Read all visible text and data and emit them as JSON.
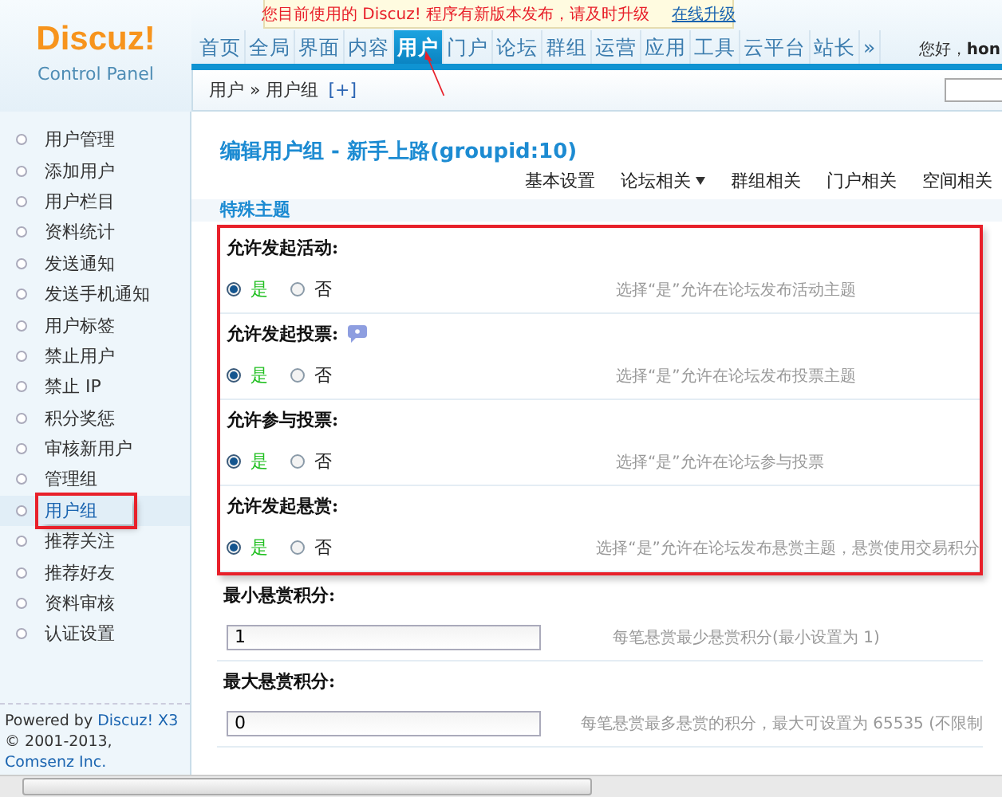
{
  "update_notice": {
    "message": "您目前使用的 Discuz! 程序有新版本发布，请及时升级",
    "link": "在线升级"
  },
  "logo": {
    "name": "Discuz!",
    "subtitle": "Control Panel"
  },
  "nav": [
    {
      "label": "首页",
      "selected": false
    },
    {
      "label": "全局",
      "selected": false
    },
    {
      "label": "界面",
      "selected": false
    },
    {
      "label": "内容",
      "selected": false
    },
    {
      "label": "用户",
      "selected": true
    },
    {
      "label": "门户",
      "selected": false
    },
    {
      "label": "论坛",
      "selected": false
    },
    {
      "label": "群组",
      "selected": false
    },
    {
      "label": "运营",
      "selected": false
    },
    {
      "label": "应用",
      "selected": false
    },
    {
      "label": "工具",
      "selected": false
    },
    {
      "label": "云平台",
      "selected": false
    },
    {
      "label": "站长",
      "selected": false
    },
    {
      "label": "»",
      "selected": false
    }
  ],
  "greeting": {
    "text": "您好，",
    "user": "hon"
  },
  "breadcrumb": {
    "path": "用户 » 用户组",
    "add": "[+]"
  },
  "sidebar": {
    "items": [
      {
        "label": "用户管理",
        "selected": false,
        "highlighted": false
      },
      {
        "label": "添加用户",
        "selected": false,
        "highlighted": false
      },
      {
        "label": "用户栏目",
        "selected": false,
        "highlighted": false
      },
      {
        "label": "资料统计",
        "selected": false,
        "highlighted": false
      },
      {
        "label": "发送通知",
        "selected": false,
        "highlighted": false
      },
      {
        "label": "发送手机通知",
        "selected": false,
        "highlighted": false
      },
      {
        "label": "用户标签",
        "selected": false,
        "highlighted": false
      },
      {
        "label": "禁止用户",
        "selected": false,
        "highlighted": false
      },
      {
        "label": "禁止 IP",
        "selected": false,
        "highlighted": false
      },
      {
        "label": "积分奖惩",
        "selected": false,
        "highlighted": false
      },
      {
        "label": "审核新用户",
        "selected": false,
        "highlighted": false
      },
      {
        "label": "管理组",
        "selected": false,
        "highlighted": false
      },
      {
        "label": "用户组",
        "selected": true,
        "highlighted": true
      },
      {
        "label": "推荐关注",
        "selected": false,
        "highlighted": false
      },
      {
        "label": "推荐好友",
        "selected": false,
        "highlighted": false
      },
      {
        "label": "资料审核",
        "selected": false,
        "highlighted": false
      },
      {
        "label": "认证设置",
        "selected": false,
        "highlighted": false
      }
    ],
    "footer": {
      "powered_by": "Powered by",
      "product": "Discuz! X3",
      "copyright": "© 2001-2013,",
      "company": "Comsenz Inc."
    }
  },
  "page_title": "编辑用户组 - 新手上路(groupid:10)",
  "sub_tabs": [
    {
      "label": "基本设置",
      "dropdown": false
    },
    {
      "label": "论坛相关",
      "dropdown": true
    },
    {
      "label": "群组相关",
      "dropdown": false
    },
    {
      "label": "门户相关",
      "dropdown": false
    },
    {
      "label": "空间相关",
      "dropdown": false
    }
  ],
  "section": "特殊主题",
  "settings": [
    {
      "kind": "radio",
      "label": "允许发起活动:",
      "help": false,
      "highlighted": true,
      "options": [
        {
          "label": "是",
          "selected": true
        },
        {
          "label": "否",
          "selected": false
        }
      ],
      "hint": "选择“是”允许在论坛发布活动主题"
    },
    {
      "kind": "radio",
      "label": "允许发起投票:",
      "help": true,
      "highlighted": true,
      "options": [
        {
          "label": "是",
          "selected": true
        },
        {
          "label": "否",
          "selected": false
        }
      ],
      "hint": "选择“是”允许在论坛发布投票主题"
    },
    {
      "kind": "radio",
      "label": "允许参与投票:",
      "help": false,
      "highlighted": true,
      "options": [
        {
          "label": "是",
          "selected": true
        },
        {
          "label": "否",
          "selected": false
        }
      ],
      "hint": "选择“是”允许在论坛参与投票"
    },
    {
      "kind": "radio",
      "label": "允许发起悬赏:",
      "help": false,
      "highlighted": true,
      "options": [
        {
          "label": "是",
          "selected": true
        },
        {
          "label": "否",
          "selected": false
        }
      ],
      "hint": "选择“是”允许在论坛发布悬赏主题，悬赏使用交易积分"
    },
    {
      "kind": "text",
      "label": "最小悬赏积分:",
      "help": false,
      "highlighted": false,
      "value": "1",
      "hint": "每笔悬赏最少悬赏积分(最小设置为 1)"
    },
    {
      "kind": "text",
      "label": "最大悬赏积分:",
      "help": false,
      "highlighted": false,
      "value": "0",
      "hint": "每笔悬赏最多悬赏的积分，最大可设置为 65535 (不限制"
    }
  ]
}
